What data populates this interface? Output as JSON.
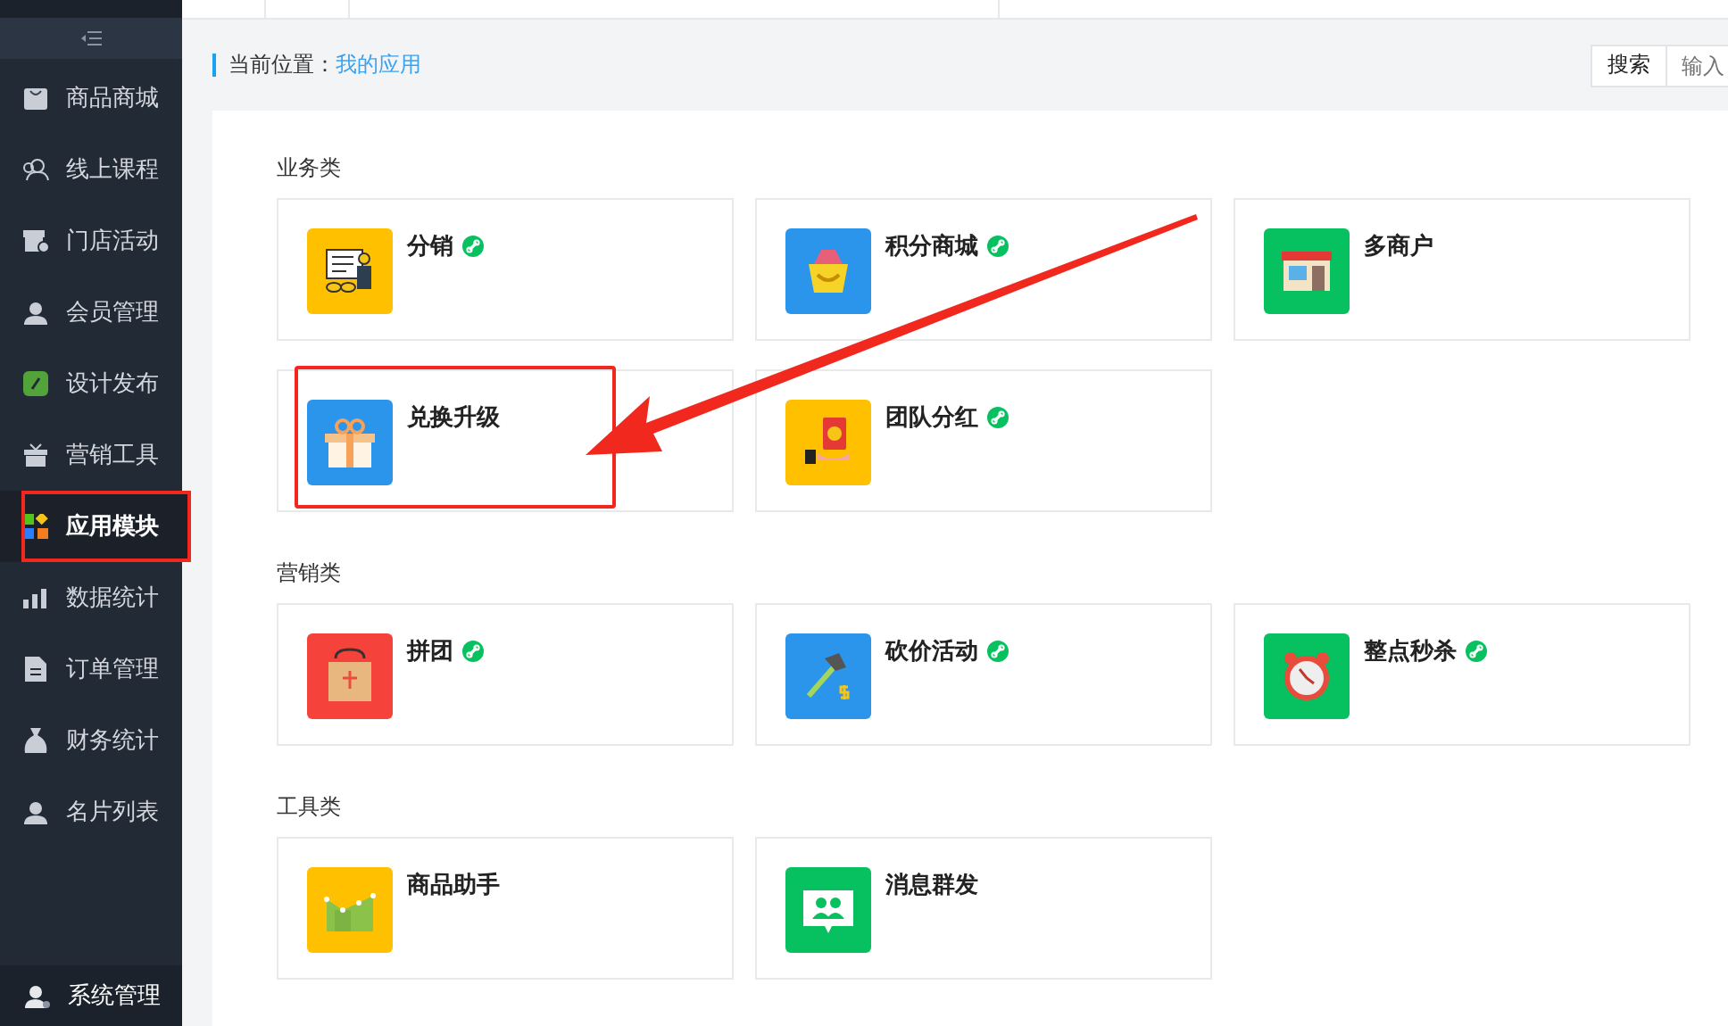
{
  "sidebar": {
    "items": [
      {
        "label": "商品商城",
        "kind": "shop",
        "selected": false,
        "highlighted": false
      },
      {
        "label": "线上课程",
        "kind": "people",
        "selected": false,
        "highlighted": false
      },
      {
        "label": "门店活动",
        "kind": "store",
        "selected": false,
        "highlighted": false
      },
      {
        "label": "会员管理",
        "kind": "user",
        "selected": false,
        "highlighted": false
      },
      {
        "label": "设计发布",
        "kind": "link",
        "selected": false,
        "highlighted": false
      },
      {
        "label": "营销工具",
        "kind": "gift",
        "selected": false,
        "highlighted": false
      },
      {
        "label": "应用模块",
        "kind": "apps",
        "selected": true,
        "highlighted": true
      },
      {
        "label": "数据统计",
        "kind": "chart",
        "selected": false,
        "highlighted": false
      },
      {
        "label": "订单管理",
        "kind": "doc",
        "selected": false,
        "highlighted": false
      },
      {
        "label": "财务统计",
        "kind": "bag",
        "selected": false,
        "highlighted": false
      },
      {
        "label": "名片列表",
        "kind": "user",
        "selected": false,
        "highlighted": false
      }
    ],
    "footer_item": {
      "label": "系统管理"
    }
  },
  "breadcrumb": {
    "label": "当前位置：",
    "current": "我的应用"
  },
  "search": {
    "button": "搜索",
    "placeholder": "输入"
  },
  "sections": [
    {
      "title": "业务类",
      "apps": [
        {
          "name": "分销",
          "kind": "presenter",
          "color": "#ffc000",
          "badge": true,
          "highlighted": false
        },
        {
          "name": "积分商城",
          "kind": "shopbag",
          "color": "#2b95ec",
          "badge": true,
          "highlighted": false
        },
        {
          "name": "多商户",
          "kind": "storefront",
          "color": "#07c160",
          "badge": false,
          "highlighted": false
        },
        {
          "name": "兑换升级",
          "kind": "giftbox",
          "color": "#2b95ec",
          "badge": false,
          "highlighted": true
        },
        {
          "name": "团队分红",
          "kind": "redpacket",
          "color": "#ffc000",
          "badge": true,
          "highlighted": false
        }
      ]
    },
    {
      "title": "营销类",
      "apps": [
        {
          "name": "拼团",
          "kind": "groupbag",
          "color": "#f5433b",
          "badge": true,
          "highlighted": false
        },
        {
          "name": "砍价活动",
          "kind": "axe",
          "color": "#2b95ec",
          "badge": true,
          "highlighted": false
        },
        {
          "name": "整点秒杀",
          "kind": "clock",
          "color": "#07c160",
          "badge": true,
          "highlighted": false
        }
      ]
    },
    {
      "title": "工具类",
      "apps": [
        {
          "name": "商品助手",
          "kind": "bars",
          "color": "#ffc000",
          "badge": false,
          "highlighted": false
        },
        {
          "name": "消息群发",
          "kind": "message",
          "color": "#07c160",
          "badge": false,
          "highlighted": false
        }
      ]
    }
  ]
}
